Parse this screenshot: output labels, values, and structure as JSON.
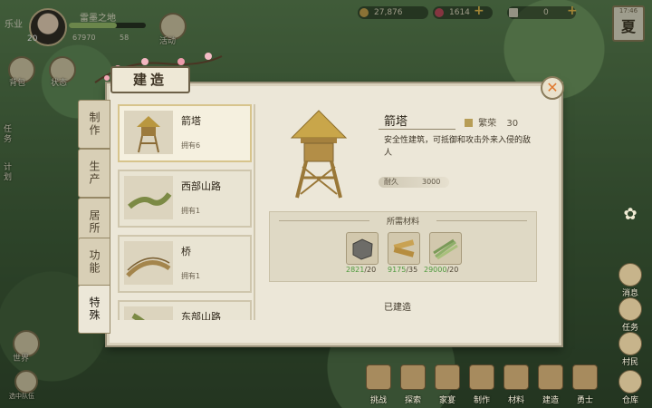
{
  "topbar": {
    "career": "乐业",
    "level": "20",
    "name": "雷墨之地",
    "stat_a": "67970",
    "stat_b": "58",
    "activity_label": "活动",
    "res_copper": "27,876",
    "res_jade": "1614",
    "res_ticket": "0",
    "time": "17:46",
    "season": "夏"
  },
  "left_side": [
    "背包",
    "状态",
    "任务",
    "计划"
  ],
  "dialog": {
    "title": "建造",
    "close_glyph": "✕",
    "categories": [
      {
        "label": "制作",
        "active": false
      },
      {
        "label": "生产",
        "active": false
      },
      {
        "label": "居所",
        "active": false
      },
      {
        "label": "功能",
        "active": false
      },
      {
        "label": "特殊",
        "active": true
      }
    ],
    "items": [
      {
        "name": "箭塔",
        "owned": "拥有6",
        "selected": true
      },
      {
        "name": "西部山路",
        "owned": "拥有1",
        "selected": false
      },
      {
        "name": "桥",
        "owned": "拥有1",
        "selected": false
      },
      {
        "name": "东部山路",
        "owned": "",
        "selected": false
      }
    ],
    "detail": {
      "name": "箭塔",
      "prosperity_label": "繁荣",
      "prosperity_value": "30",
      "description": "安全性建筑，可抵御和攻击外来入侵的敌人",
      "durability_label": "耐久",
      "durability_value": "3000",
      "materials_title": "所需材料",
      "materials": [
        {
          "icon": "stone-icon",
          "have": "2821",
          "need": "/20"
        },
        {
          "icon": "wood-icon",
          "have": "9175",
          "need": "/35"
        },
        {
          "icon": "bamboo-icon",
          "have": "29000",
          "need": "/20"
        }
      ],
      "status": "已建造"
    }
  },
  "right_side": [
    "消息",
    "任务",
    "村民",
    "仓库"
  ],
  "bottom_left": [
    "世界",
    "选中队伍"
  ],
  "bottombar": [
    "挑战",
    "探索",
    "家宴",
    "制作",
    "材料",
    "建造",
    "勇士"
  ],
  "colors": {
    "have_count": "#4f9a3e",
    "close": "#e07a2f",
    "accent_gold": "#b79d56"
  }
}
